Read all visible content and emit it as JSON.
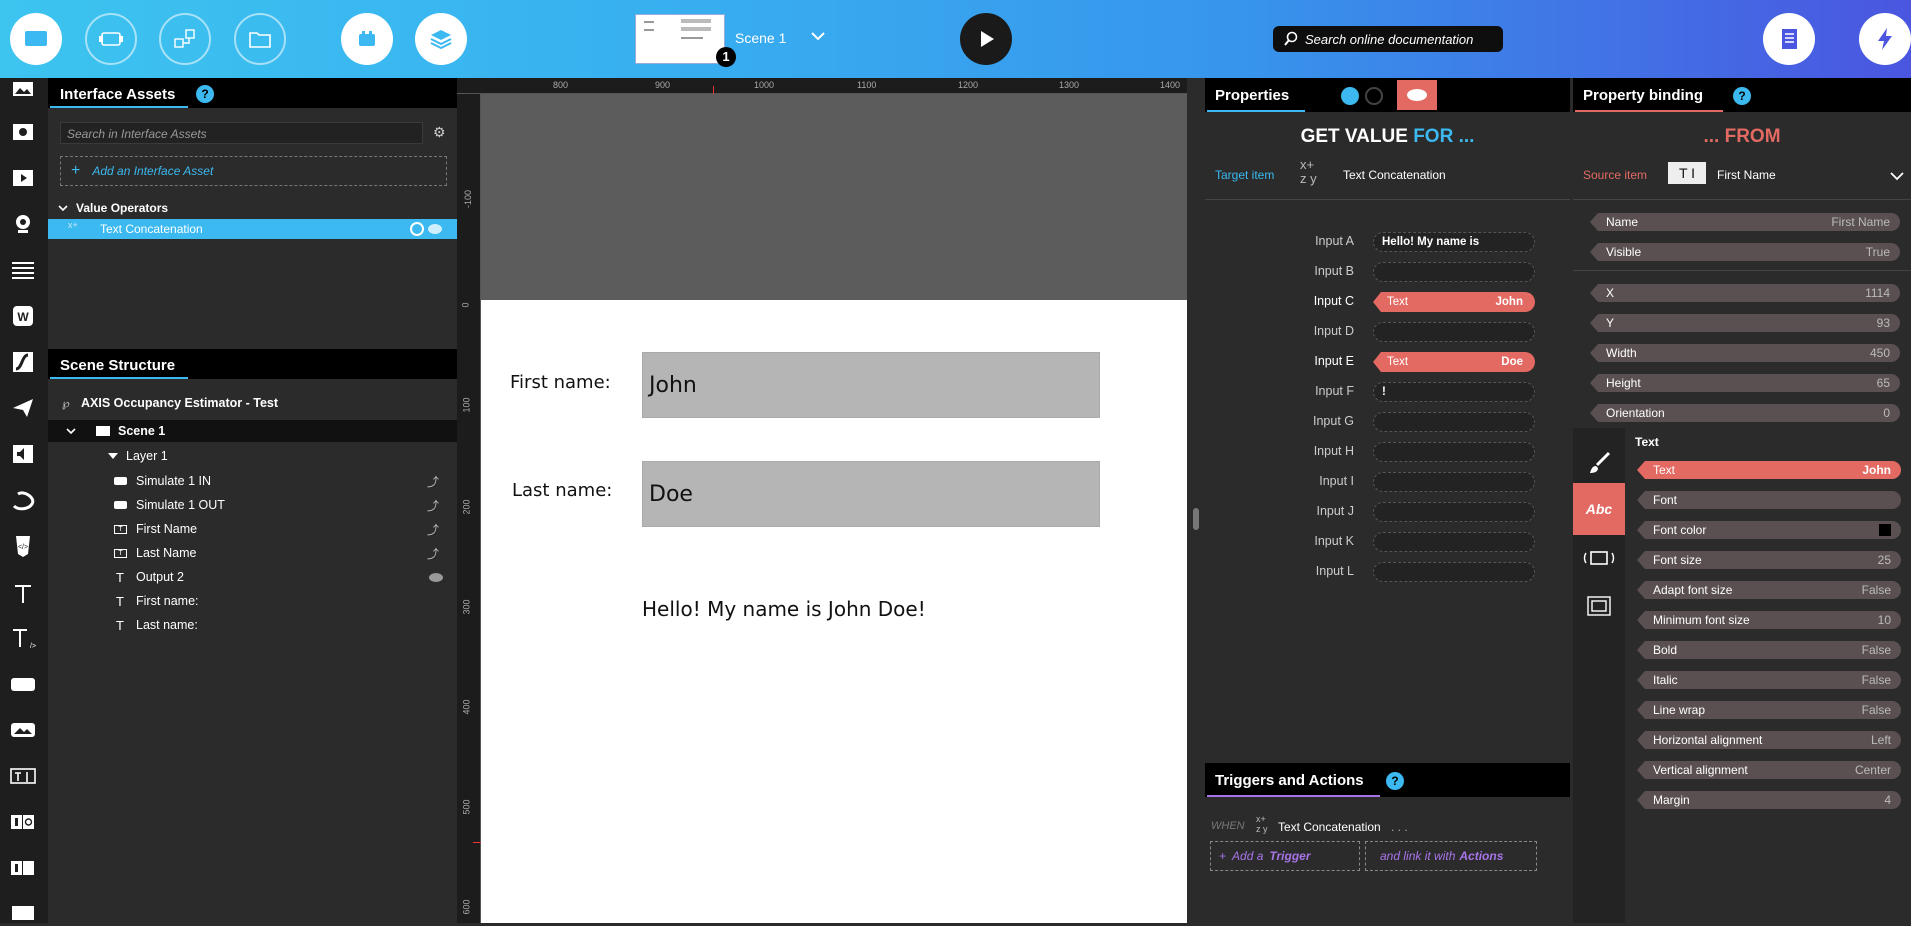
{
  "topbar": {
    "scene_label": "Scene 1",
    "scene_badge": "1",
    "search_placeholder": "Search online documentation"
  },
  "assets": {
    "title": "Interface Assets",
    "help": "?",
    "search_placeholder": "Search in Interface Assets",
    "add_label": "Add an Interface Asset",
    "group_label": "Value Operators",
    "selected_item": "Text Concatenation"
  },
  "scene_structure": {
    "title": "Scene Structure",
    "project": "AXIS Occupancy Estimator - Test",
    "scene": "Scene 1",
    "layer": "Layer 1",
    "items": [
      {
        "label": "Simulate 1 IN",
        "icon": "button-icon"
      },
      {
        "label": "Simulate 1 OUT",
        "icon": "button-icon"
      },
      {
        "label": "First Name",
        "icon": "text-input-icon"
      },
      {
        "label": "Last Name",
        "icon": "text-input-icon"
      },
      {
        "label": "Output 2",
        "icon": "text-icon"
      },
      {
        "label": "First name:",
        "icon": "text-icon"
      },
      {
        "label": "Last name:",
        "icon": "text-icon"
      }
    ]
  },
  "canvas": {
    "ruler_top": [
      "800",
      "900",
      "1000",
      "1100",
      "1200",
      "1300",
      "1400"
    ],
    "ruler_left": [
      "-100",
      "0",
      "100",
      "200",
      "300",
      "400",
      "500",
      "600"
    ],
    "first_label": "First name:",
    "first_value": "John",
    "last_label": "Last name:",
    "last_value": "Doe",
    "output": "Hello! My name is John Doe!"
  },
  "properties": {
    "title": "Properties",
    "heading_a": "GET VALUE",
    "heading_b": "FOR ...",
    "target_label": "Target item",
    "target_value": "Text Concatenation",
    "inputs": [
      {
        "label": "Input A",
        "value": "Hello! My name is"
      },
      {
        "label": "Input B",
        "value": ""
      },
      {
        "label": "Input C",
        "type": "Text",
        "value": "John"
      },
      {
        "label": "Input D",
        "value": ""
      },
      {
        "label": "Input E",
        "type": "Text",
        "value": "Doe"
      },
      {
        "label": "Input F",
        "value": "!"
      },
      {
        "label": "Input G",
        "value": ""
      },
      {
        "label": "Input H",
        "value": ""
      },
      {
        "label": "Input I",
        "value": ""
      },
      {
        "label": "Input J",
        "value": ""
      },
      {
        "label": "Input K",
        "value": ""
      },
      {
        "label": "Input L",
        "value": ""
      }
    ]
  },
  "triggers": {
    "title": "Triggers and Actions",
    "help": "?",
    "when": "WHEN",
    "item": "Text Concatenation",
    "dots": ". . .",
    "add_prefix": "Add a",
    "add_trigger": "Trigger",
    "link_prefix": "and link it with",
    "link_actions": "Actions"
  },
  "binding": {
    "title": "Property binding",
    "help": "?",
    "heading": "... FROM",
    "source_label": "Source item",
    "source_value": "First Name",
    "common": [
      {
        "key": "Name",
        "value": "First Name"
      },
      {
        "key": "Visible",
        "value": "True"
      }
    ],
    "geometry": [
      {
        "key": "X",
        "value": "1114"
      },
      {
        "key": "Y",
        "value": "93"
      },
      {
        "key": "Width",
        "value": "450"
      },
      {
        "key": "Height",
        "value": "65"
      },
      {
        "key": "Orientation",
        "value": "0"
      }
    ],
    "section": "Text",
    "text_props": [
      {
        "key": "Text",
        "value": "John",
        "bound": true
      },
      {
        "key": "Font",
        "value": ""
      },
      {
        "key": "Font color",
        "value": ""
      },
      {
        "key": "Font size",
        "value": "25"
      },
      {
        "key": "Adapt font size",
        "value": "False"
      },
      {
        "key": "Minimum font size",
        "value": "10"
      },
      {
        "key": "Bold",
        "value": "False"
      },
      {
        "key": "Italic",
        "value": "False"
      },
      {
        "key": "Line wrap",
        "value": "False"
      },
      {
        "key": "Horizontal alignment",
        "value": "Left"
      },
      {
        "key": "Vertical alignment",
        "value": "Center"
      },
      {
        "key": "Margin",
        "value": "4"
      }
    ],
    "abc_tab": "Abc"
  },
  "colors": {
    "accent_blue": "#3bb9f0",
    "bound_red": "#e36a63",
    "heading_blue": "#3bb9f0",
    "from_red": "#e36a63"
  }
}
